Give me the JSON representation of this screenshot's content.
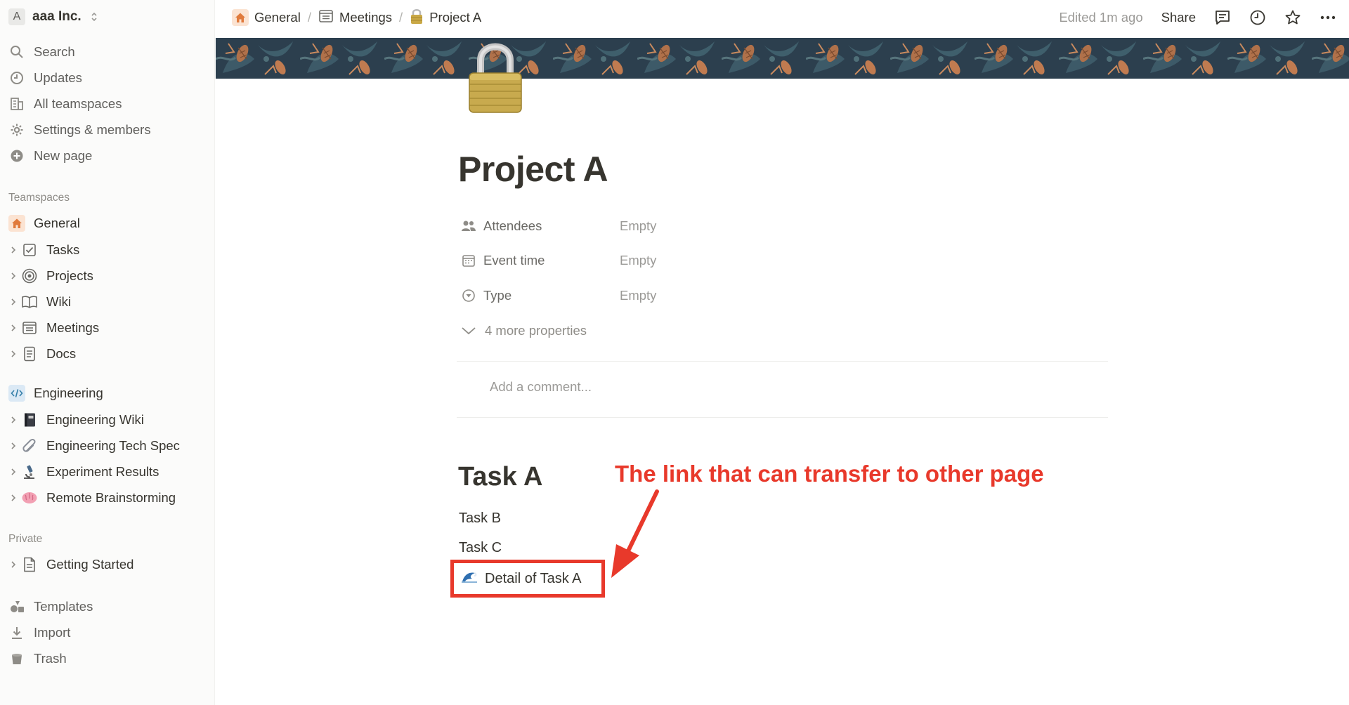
{
  "workspace": {
    "avatar": "A",
    "name": "aaa Inc."
  },
  "sidebar": {
    "top": [
      {
        "label": "Search",
        "icon": "search-icon"
      },
      {
        "label": "Updates",
        "icon": "clock-icon"
      },
      {
        "label": "All teamspaces",
        "icon": "building-icon"
      },
      {
        "label": "Settings & members",
        "icon": "gear-icon"
      },
      {
        "label": "New page",
        "icon": "plus-circle-icon"
      }
    ],
    "teamspaces_label": "Teamspaces",
    "general": {
      "label": "General",
      "icon": "home-icon"
    },
    "general_items": [
      {
        "label": "Tasks",
        "icon": "checkbox-icon"
      },
      {
        "label": "Projects",
        "icon": "target-icon"
      },
      {
        "label": "Wiki",
        "icon": "book-icon"
      },
      {
        "label": "Meetings",
        "icon": "calendar-note-icon"
      },
      {
        "label": "Docs",
        "icon": "document-icon"
      }
    ],
    "engineering": {
      "label": "Engineering",
      "icon": "code-icon"
    },
    "engineering_items": [
      {
        "label": "Engineering Wiki",
        "icon": "notebook-icon"
      },
      {
        "label": "Engineering Tech Spec",
        "icon": "paperclip-icon"
      },
      {
        "label": "Experiment Results",
        "icon": "microscope-icon"
      },
      {
        "label": "Remote Brainstorming",
        "icon": "brain-icon"
      }
    ],
    "private_label": "Private",
    "private_items": [
      {
        "label": "Getting Started",
        "icon": "page-icon"
      }
    ],
    "bottom": [
      {
        "label": "Templates",
        "icon": "templates-icon"
      },
      {
        "label": "Import",
        "icon": "download-icon"
      },
      {
        "label": "Trash",
        "icon": "trash-icon"
      }
    ]
  },
  "breadcrumb": [
    {
      "label": "General"
    },
    {
      "label": "Meetings"
    },
    {
      "label": "Project A"
    }
  ],
  "breadcrumb_sep": "/",
  "topbar": {
    "edited": "Edited 1m ago",
    "share": "Share"
  },
  "page": {
    "title": "Project A",
    "properties": [
      {
        "name": "Attendees",
        "value": "Empty",
        "icon": "people-icon"
      },
      {
        "name": "Event time",
        "value": "Empty",
        "icon": "calendar-icon"
      },
      {
        "name": "Type",
        "value": "Empty",
        "icon": "select-icon"
      }
    ],
    "more_properties": "4 more properties",
    "comment_placeholder": "Add a comment...",
    "heading": "Task A",
    "paragraphs": [
      "Task B",
      "Task C"
    ],
    "link": {
      "label": "Detail of Task A",
      "icon": "wave-icon"
    }
  },
  "annotation": {
    "text": "The link that can transfer to other page",
    "color": "#e8392b"
  }
}
